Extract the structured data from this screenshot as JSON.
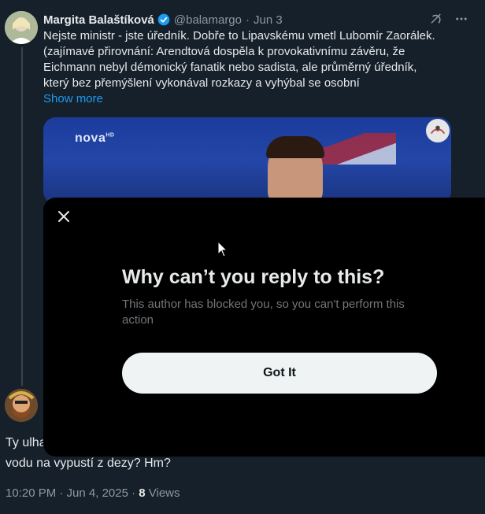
{
  "tweet": {
    "author_name": "Margita Balaštíková",
    "handle": "@balamargo",
    "separator": "·",
    "date": "Jun 3",
    "text_lines": [
      "Nejste ministr - jste úředník. Dobře to Lipavskému vmetl Lubomír Zaorálek.",
      "(zajímavé přirovnání: Arendtová dospěla k provokativnímu závěru, že",
      "Eichmann nebyl démonický fanatik nebo sadista, ale průměrný úředník,",
      "který bez přemýšlení vykonával rozkazy a vyhýbal se osobní"
    ],
    "show_more": "Show more",
    "media_logo": "nova",
    "media_logo_sup": "HD"
  },
  "reply": {
    "text_lines": [
      "Ty ulha",
      "vodu na vypustí z dezy? Hm?"
    ],
    "time": "10:20 PM · Jun 4, 2025 · ",
    "views_count": "8",
    "views_label": " Views"
  },
  "dialog": {
    "title": "Why can’t you reply to this?",
    "subtitle": "This author has blocked you, so you can't perform this action",
    "button_label": "Got It"
  },
  "icons": {
    "verified": "verified-badge-icon",
    "grok": "grok-icon",
    "more": "more-icon",
    "close": "close-icon",
    "cursor": "mouse-cursor-icon"
  },
  "colors": {
    "background": "#15202b",
    "accent": "#1d9bf0",
    "dialog": "#000000",
    "button": "#eff3f4"
  }
}
